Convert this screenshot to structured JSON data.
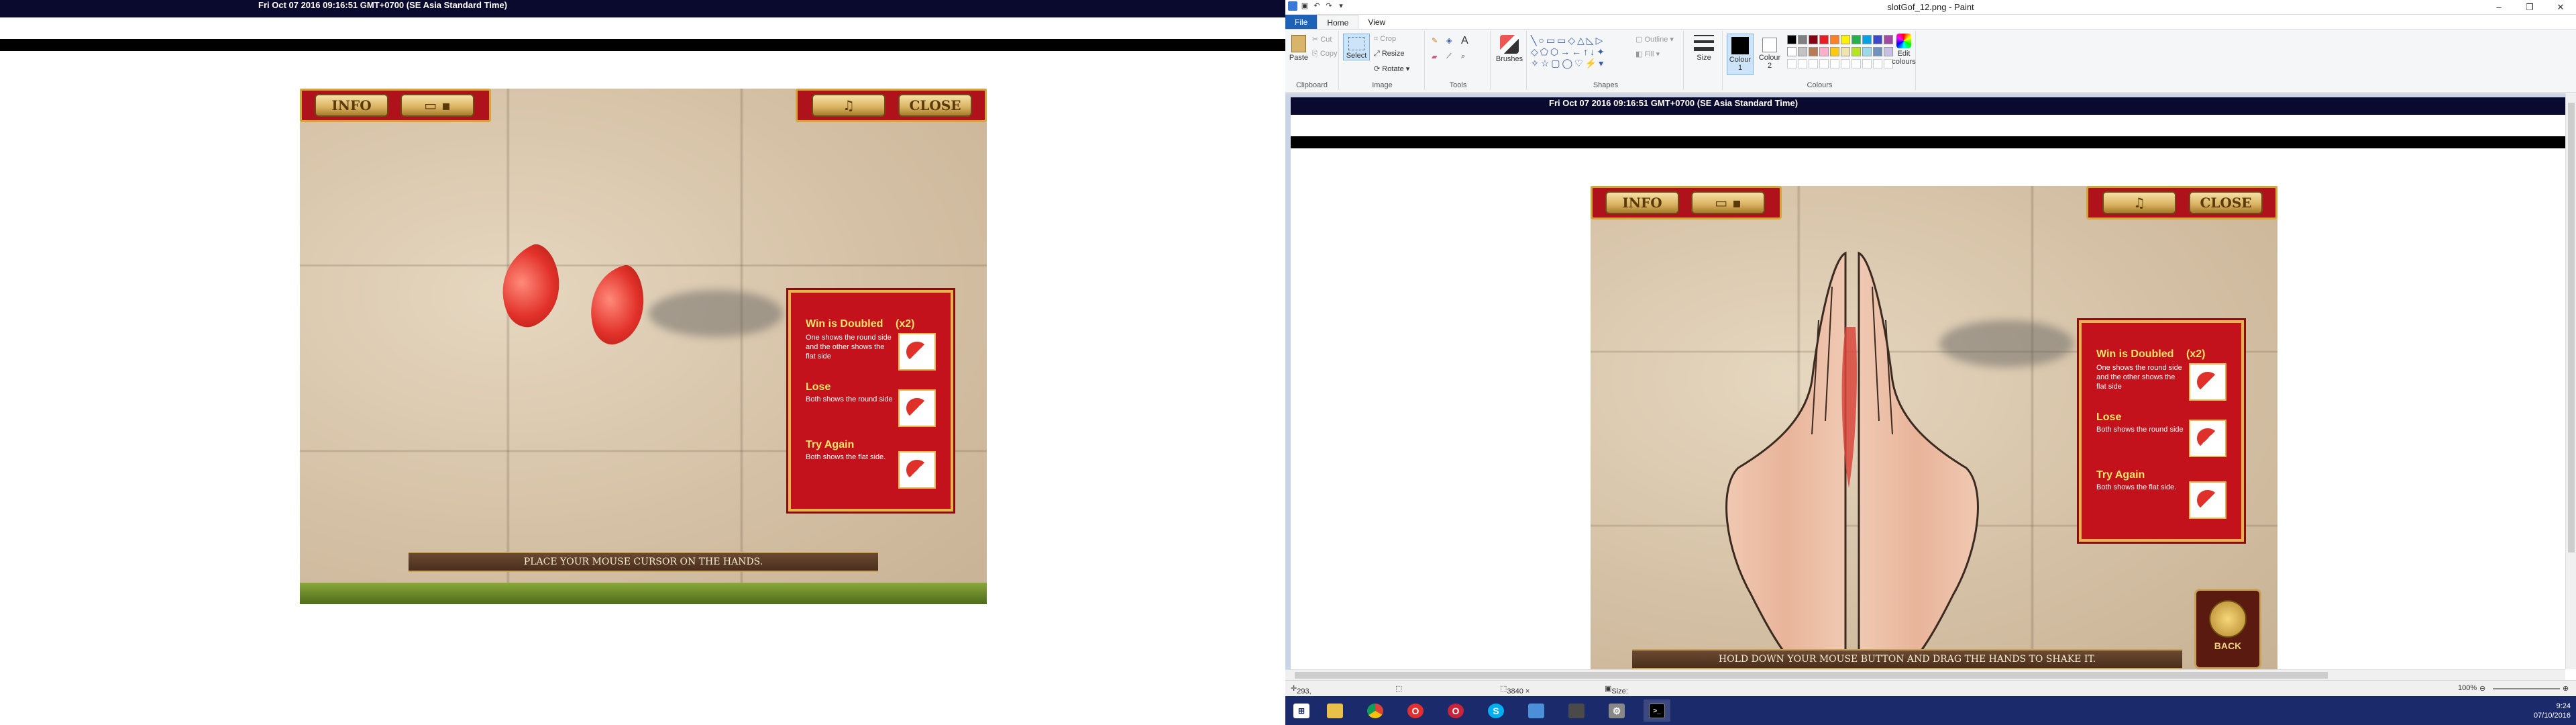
{
  "left_screen": {
    "timestamp": "Fri Oct 07 2016 09:16:51 GMT+0700 (SE Asia Standard Time)",
    "game": {
      "info_label": "INFO",
      "close_label": "CLOSE",
      "prompt": "PLACE YOUR MOUSE CURSOR ON THE HANDS."
    }
  },
  "rules_panel": {
    "win_title": "Win is Doubled",
    "win_multiplier": "(x2)",
    "win_desc": "One shows the round side and the other shows the flat side",
    "lose_title": "Lose",
    "lose_desc": "Both shows the round side",
    "try_title": "Try Again",
    "try_desc": "Both shows the flat side."
  },
  "paint": {
    "window_title": "slotGof_12.png - Paint",
    "tabs": [
      "File",
      "Home",
      "View"
    ],
    "clipboard": {
      "paste": "Paste",
      "cut": "Cut",
      "copy": "Copy",
      "group": "Clipboard"
    },
    "image": {
      "select": "Select",
      "crop": "Crop",
      "resize": "Resize",
      "rotate": "Rotate",
      "group": "Image"
    },
    "tools_group": "Tools",
    "brushes": "Brushes",
    "shapes": {
      "outline": "Outline",
      "fill": "Fill",
      "group": "Shapes"
    },
    "size": "Size",
    "colour1": "Colour 1",
    "colour2": "Colour 2",
    "edit_colours": "Edit colours",
    "colours_group": "Colours",
    "palette": [
      "#000000",
      "#7f7f7f",
      "#880015",
      "#ed1c24",
      "#ff7f27",
      "#fff200",
      "#22b14c",
      "#00a2e8",
      "#3f48cc",
      "#a349a4",
      "#ffffff",
      "#c3c3c3",
      "#b97a57",
      "#ffaec9",
      "#ffc90e",
      "#efe4b0",
      "#b5e61d",
      "#99d9ea",
      "#7092be",
      "#c8bfe7"
    ],
    "canvas": {
      "timestamp": "Fri Oct 07 2016 09:16:51 GMT+0700 (SE Asia Standard Time)",
      "info_label": "INFO",
      "close_label": "CLOSE",
      "prompt": "HOLD DOWN YOUR MOUSE BUTTON AND DRAG THE HANDS TO SHAKE IT.",
      "back_label": "BACK"
    },
    "status": {
      "cursor": "293, 361px",
      "dimensions": "3840 × 1080px",
      "size": "Size: 2.5MB",
      "zoom": "100%"
    }
  },
  "taskbar": {
    "items": [
      "start-button",
      "file-explorer",
      "chrome",
      "opera-red",
      "opera",
      "skype",
      "note-app",
      "terminal-app",
      "settings-app",
      "cmd"
    ],
    "time": "9:24",
    "date": "07/10/2016"
  }
}
